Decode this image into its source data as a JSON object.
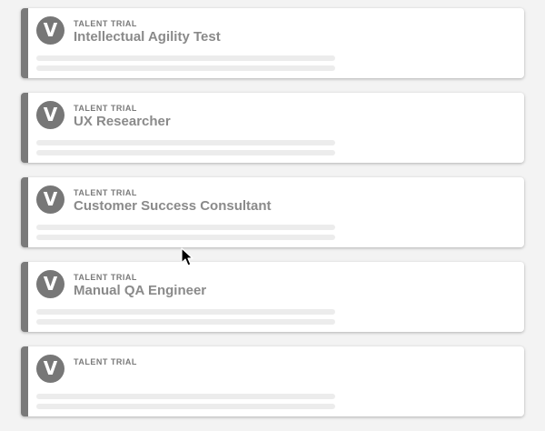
{
  "cards": [
    {
      "eyebrow": "TALENT TRIAL",
      "title": "Intellectual Agility Test",
      "avatar_letter": "V"
    },
    {
      "eyebrow": "TALENT TRIAL",
      "title": "UX Researcher",
      "avatar_letter": "V"
    },
    {
      "eyebrow": "TALENT TRIAL",
      "title": "Customer Success Consultant",
      "avatar_letter": "V"
    },
    {
      "eyebrow": "TALENT TRIAL",
      "title": "Manual QA Engineer",
      "avatar_letter": "V"
    },
    {
      "eyebrow": "TALENT TRIAL",
      "title": "",
      "avatar_letter": "V"
    }
  ],
  "colors": {
    "accent_bar": "#7a7a7a",
    "avatar_bg": "#777777",
    "page_bg": "#f3f3f3",
    "skeleton": "#ececec"
  },
  "icons": {
    "cursor": "mouse-pointer-icon"
  }
}
